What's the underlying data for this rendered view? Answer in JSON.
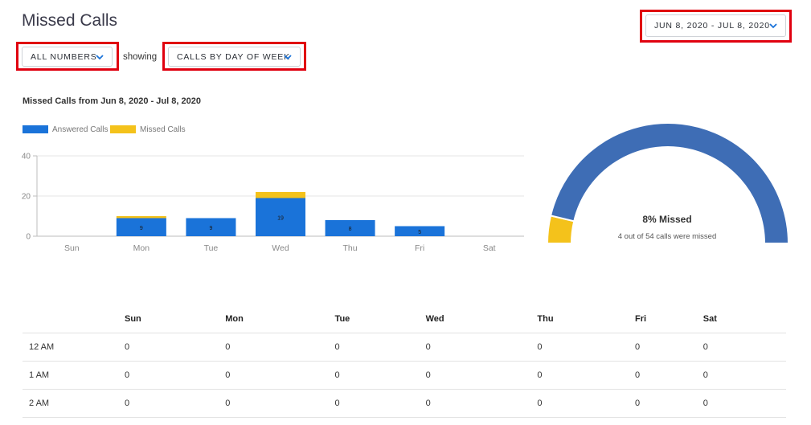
{
  "page": {
    "title": "Missed Calls"
  },
  "filters": {
    "numbers_label": "ALL NUMBERS",
    "showing_label": "showing",
    "view_label": "CALLS BY DAY OF WEEK",
    "date_range_label": "JUN 8, 2020 - JUL 8, 2020"
  },
  "colors": {
    "answered": "#1a73d9",
    "missed": "#f4c21b",
    "gauge_answered": "#3e6db5",
    "highlight": "#e0000f"
  },
  "icons": {
    "dropdown": "chevron-down-icon"
  },
  "chart_data": [
    {
      "type": "bar",
      "title": "Missed Calls from Jun 8, 2020 - Jul 8, 2020",
      "categories": [
        "Sun",
        "Mon",
        "Tue",
        "Wed",
        "Thu",
        "Fri",
        "Sat"
      ],
      "series": [
        {
          "name": "Answered Calls",
          "values": [
            0,
            9,
            9,
            19,
            8,
            5,
            0
          ]
        },
        {
          "name": "Missed Calls",
          "values": [
            0,
            1,
            0,
            3,
            0,
            0,
            0
          ]
        }
      ],
      "data_labels": [
        "",
        "9",
        "9",
        "19",
        "8",
        "5",
        ""
      ],
      "stacked": true,
      "ylim": [
        0,
        40
      ],
      "yticks": [
        0,
        20,
        40
      ],
      "grid": true,
      "legend": "top-left"
    },
    {
      "type": "pie",
      "shape": "half-donut",
      "slices": [
        {
          "value": 4
        },
        {
          "value": 50
        }
      ],
      "center_title": "8% Missed",
      "center_subtitle": "4 out of 54 calls were missed"
    }
  ],
  "table": {
    "columns": [
      "",
      "Sun",
      "Mon",
      "Tue",
      "Wed",
      "Thu",
      "Fri",
      "Sat"
    ],
    "rows": [
      [
        "12 AM",
        "0",
        "0",
        "0",
        "0",
        "0",
        "0",
        "0"
      ],
      [
        "1 AM",
        "0",
        "0",
        "0",
        "0",
        "0",
        "0",
        "0"
      ],
      [
        "2 AM",
        "0",
        "0",
        "0",
        "0",
        "0",
        "0",
        "0"
      ]
    ]
  }
}
